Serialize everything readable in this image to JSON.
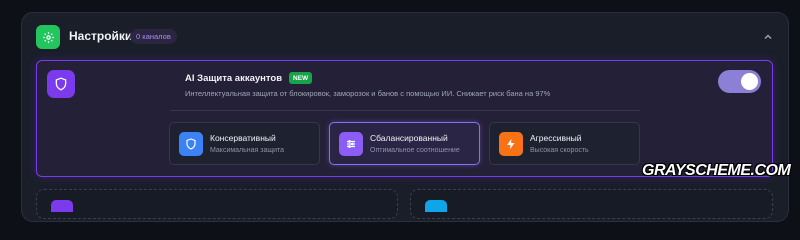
{
  "header": {
    "title": "Настройки",
    "channels_badge": "0 каналов",
    "icon": "gear-icon",
    "accent": "#22c55e"
  },
  "ai_protection": {
    "title": "AI Защита аккаунтов",
    "new_badge": "NEW",
    "description": "Интеллектуальная защита от блокировок, заморозок и банов с помощью ИИ. Снижает риск бана на 97%",
    "enabled": true,
    "icon": "shield-icon",
    "accent": "#7c3aed"
  },
  "modes": [
    {
      "title": "Консервативный",
      "subtitle": "Максимальная защита",
      "icon": "shield-icon",
      "color": "#3b82f6",
      "selected": false
    },
    {
      "title": "Сбалансированный",
      "subtitle": "Оптимальное соотношение",
      "icon": "sliders-icon",
      "color": "#8b5cf6",
      "selected": true
    },
    {
      "title": "Агрессивный",
      "subtitle": "Высокая скорость",
      "icon": "lightning-icon",
      "color": "#f97316",
      "selected": false
    }
  ],
  "watermark": "GRAYSCHEME.COM"
}
